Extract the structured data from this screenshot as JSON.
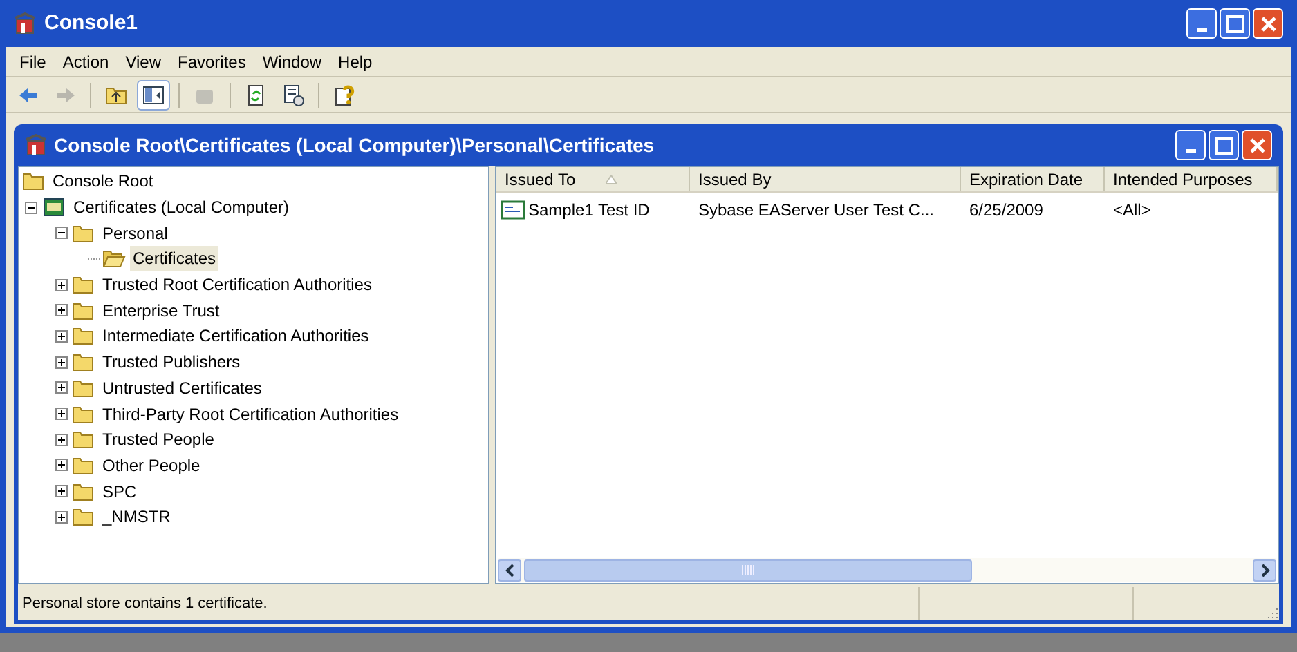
{
  "window": {
    "title": "Console1"
  },
  "menu": [
    "File",
    "Action",
    "View",
    "Favorites",
    "Window",
    "Help"
  ],
  "toolbar": [
    {
      "disabled": false,
      "pressed": false
    },
    {
      "disabled": true,
      "pressed": false
    },
    {
      "disabled": false,
      "pressed": false
    },
    {
      "disabled": false,
      "pressed": true
    },
    {
      "disabled": true,
      "pressed": false
    },
    {
      "disabled": false,
      "pressed": false
    },
    {
      "disabled": false,
      "pressed": false
    },
    {
      "disabled": false,
      "pressed": false
    }
  ],
  "child_window": {
    "title": "Console Root\\Certificates (Local Computer)\\Personal\\Certificates"
  },
  "tree": [
    {
      "label": "Console Root",
      "selected": false,
      "children": [
        {
          "label": "Certificates (Local Computer)",
          "selected": false,
          "expanded": true,
          "children": [
            {
              "label": "Personal",
              "selected": false,
              "expanded": true,
              "children": [
                {
                  "label": "Certificates",
                  "selected": true
                }
              ]
            },
            {
              "label": "Trusted Root Certification Authorities",
              "selected": false,
              "expanded": false
            },
            {
              "label": "Enterprise Trust",
              "selected": false,
              "expanded": false
            },
            {
              "label": "Intermediate Certification Authorities",
              "selected": false,
              "expanded": false
            },
            {
              "label": "Trusted Publishers",
              "selected": false,
              "expanded": false
            },
            {
              "label": "Untrusted Certificates",
              "selected": false,
              "expanded": false
            },
            {
              "label": "Third-Party Root Certification Authorities",
              "selected": false,
              "expanded": false
            },
            {
              "label": "Trusted People",
              "selected": false,
              "expanded": false
            },
            {
              "label": "Other People",
              "selected": false,
              "expanded": false
            },
            {
              "label": "SPC",
              "selected": false,
              "expanded": false
            },
            {
              "label": "_NMSTR",
              "selected": false,
              "expanded": false
            }
          ]
        }
      ]
    }
  ],
  "table": {
    "columns": [
      {
        "label": "Issued To",
        "sorted": true
      },
      {
        "label": "Issued By",
        "sorted": false
      },
      {
        "label": "Expiration Date",
        "sorted": false
      },
      {
        "label": "Intended Purposes",
        "sorted": false
      }
    ],
    "rows": [
      [
        "Sample1 Test ID",
        "Sybase EAServer User Test C...",
        "6/25/2009",
        "<All>"
      ]
    ]
  },
  "status_bar": "Personal store contains 1 certificate."
}
